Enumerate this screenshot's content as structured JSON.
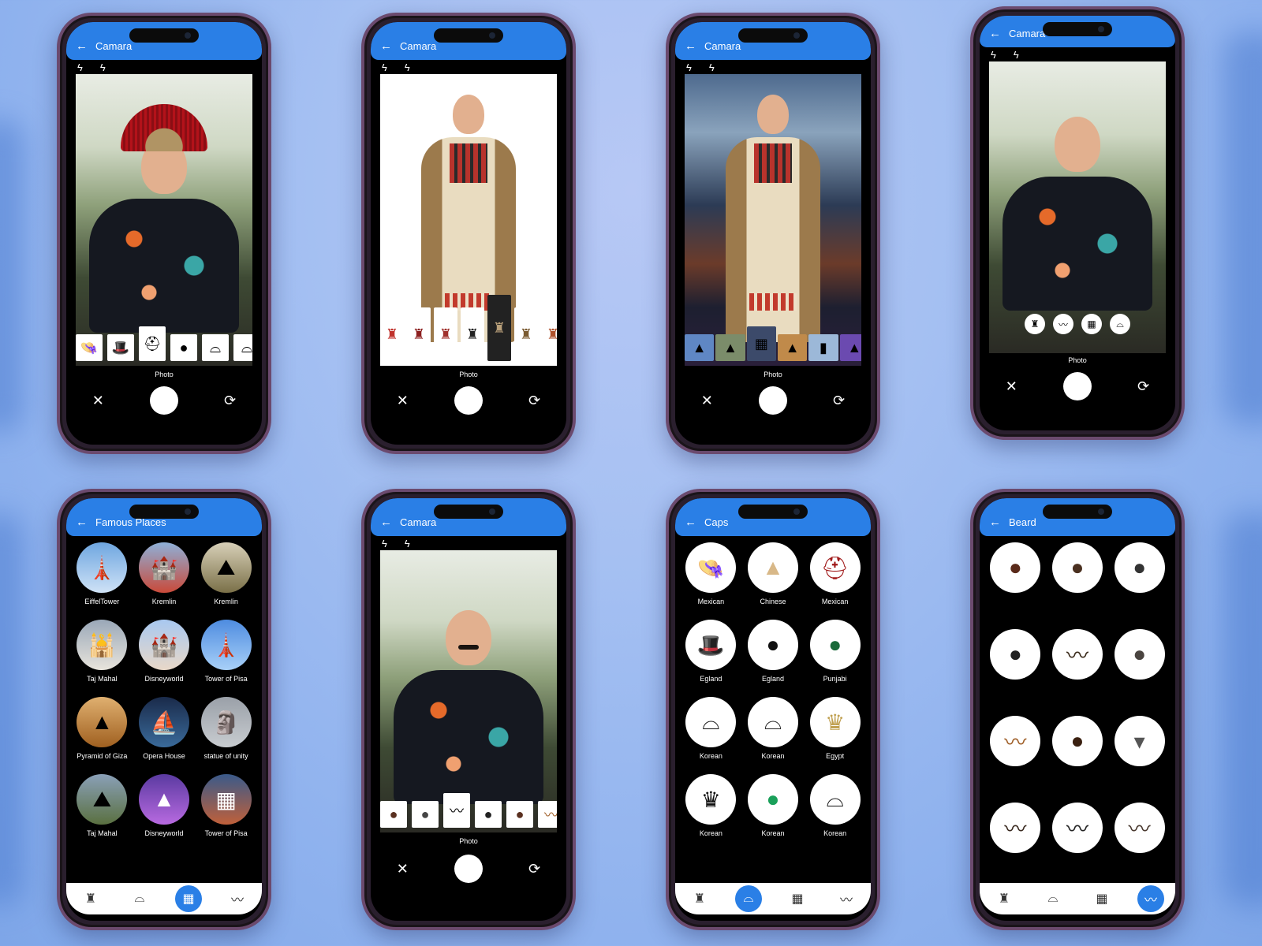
{
  "appbar": {
    "camara": "Camara",
    "famous_places": "Famous Places",
    "caps": "Caps",
    "beard": "Beard"
  },
  "camera": {
    "photo_label": "Photo"
  },
  "places": [
    "EiffelTower",
    "Kremlin",
    "Kremlin",
    "Taj Mahal",
    "Disneyworld",
    "Tower of Pisa",
    "Pyramid of Giza",
    "Opera House",
    "statue of unity",
    "Taj Mahal",
    "Disneyworld",
    "Tower of Pisa"
  ],
  "caps": [
    "Mexican",
    "Chinese",
    "Mexican",
    "Egland",
    "Egland",
    "Punjabi",
    "Korean",
    "Korean",
    "Egypt",
    "Korean",
    "Korean",
    "Korean"
  ],
  "colors": {
    "accent": "#2a7fe6"
  }
}
